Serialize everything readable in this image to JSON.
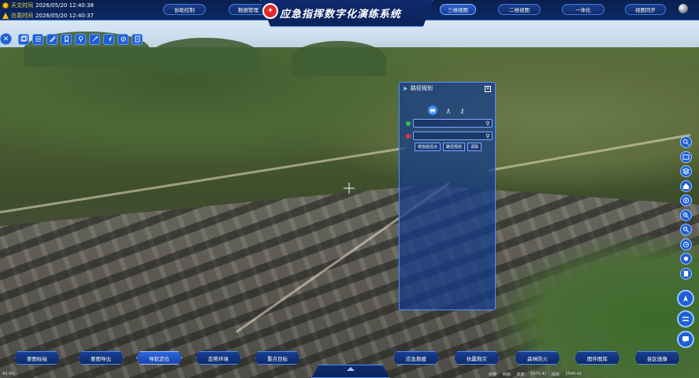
{
  "top": {
    "time_rows": [
      {
        "label": "天文时间",
        "value": "2026/05/20 12:40:38"
      },
      {
        "label": "仿真时间",
        "value": "2026/05/20 12:40:37"
      }
    ],
    "nav_left": [
      "协助控制",
      "数据管理"
    ],
    "title": "应急指挥数字化演练系统",
    "nav_right": [
      "三维视图",
      "二维视图",
      "一体化",
      "视图同步"
    ],
    "active_nav": "三维视图"
  },
  "left_toolbar": {
    "icons": [
      "close-icon",
      "layers-icon",
      "list-icon",
      "measure-icon",
      "bookmark-icon",
      "location-icon",
      "draw-icon",
      "flight-icon",
      "settings-icon",
      "export-icon"
    ]
  },
  "right_toolbar": {
    "icons": [
      "search-icon",
      "image-icon",
      "layers-icon",
      "home-icon",
      "compass-icon",
      "zoom-in-icon",
      "zoom-out-icon",
      "history-icon",
      "weather-icon",
      "doc-icon"
    ],
    "big_buttons": [
      "navigate-icon",
      "split-icon",
      "chat-icon"
    ]
  },
  "route_panel": {
    "title": "路径规划",
    "modes": [
      "car-icon",
      "walk-route-icon",
      "walk-icon"
    ],
    "start_placeholder": "",
    "end_placeholder": "",
    "actions": [
      "增加途径点",
      "路径规划",
      "清除"
    ],
    "colors": {
      "start": "#2fc24a",
      "end": "#e03a3a"
    }
  },
  "bottom": {
    "buttons": [
      "要图标绘",
      "要图导出",
      "导航定位",
      "态势环境",
      "重点目标",
      "应急救援",
      "抗震救灾",
      "森林防火",
      "图件图库",
      "县区画像"
    ],
    "active": "导航定位"
  },
  "status": {
    "left": "43.9%",
    "right": [
      "经度:",
      "纬度:",
      "高度:",
      "1970.41",
      "视高:",
      "2540.42"
    ]
  }
}
